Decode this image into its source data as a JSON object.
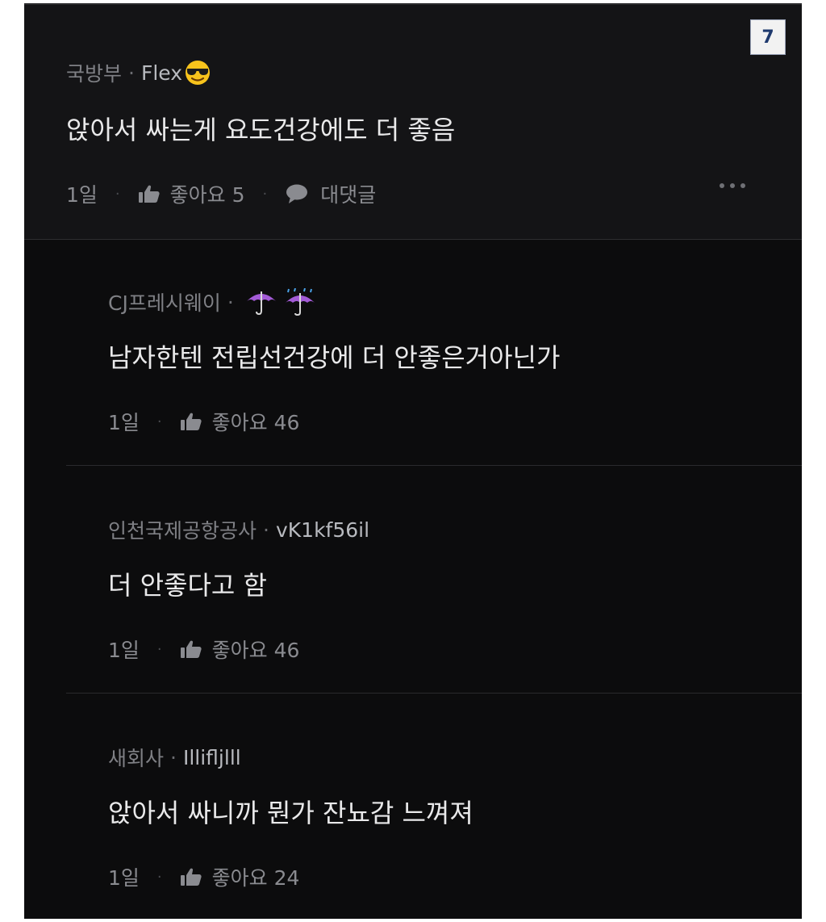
{
  "badge": "7",
  "parent": {
    "company": "국방부",
    "dot": "·",
    "nickname": "Flex",
    "nickname_emoji": "smiling-face-with-sunglasses-icon",
    "text": "앉아서 싸는게 요도건강에도 더 좋음",
    "age": "1일",
    "like_label": "좋아요 5",
    "reply_label": "대댓글"
  },
  "replies": [
    {
      "company": "CJ프레시웨이",
      "dot": "·",
      "nickname": "",
      "nickname_emojis": [
        "umbrella-icon",
        "umbrella-with-rain-icon"
      ],
      "text": "남자한텐 전립선건강에 더 안좋은거아닌가",
      "age": "1일",
      "like_label": "좋아요 46"
    },
    {
      "company": "인천국제공항공사",
      "dot": "·",
      "nickname": "vK1kf56il",
      "text": "더 안좋다고 함",
      "age": "1일",
      "like_label": "좋아요 46"
    },
    {
      "company": "새회사",
      "dot": "·",
      "nickname": "Illifljlll",
      "text": "앉아서 싸니까 뭔가 잔뇨감 느껴져",
      "age": "1일",
      "like_label": "좋아요 24"
    }
  ],
  "colors": {
    "background": "#0c0c0d",
    "parent_background": "#141416",
    "text": "#e9e9ea",
    "meta": "#7f8085",
    "accent_badge": "#1f3a6e",
    "umbrella": "#a35bd6"
  }
}
